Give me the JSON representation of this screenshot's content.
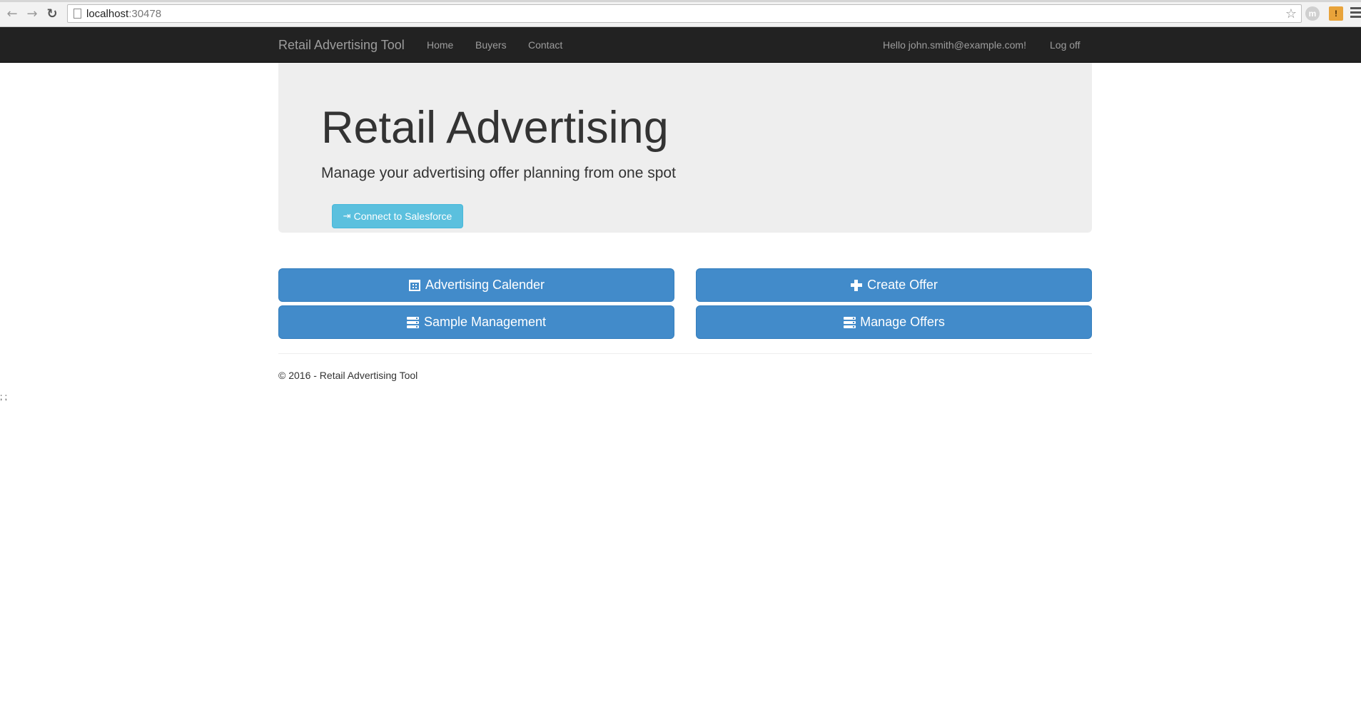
{
  "browser": {
    "back_glyph": "←",
    "forward_glyph": "→",
    "reload_glyph": "↻",
    "url_host": "localhost",
    "url_port": ":30478",
    "star_glyph": "☆",
    "extension_m": "m",
    "extension_b": "!"
  },
  "navbar": {
    "brand": "Retail Advertising Tool",
    "links": [
      "Home",
      "Buyers",
      "Contact"
    ],
    "greeting": "Hello john.smith@example.com!",
    "logoff": "Log off",
    "background": "#222222",
    "text_color": "#9d9d9d"
  },
  "jumbotron": {
    "title": "Retail Advertising",
    "lead": "Manage your advertising offer planning from one spot",
    "connect_icon": "⇥",
    "connect_label": "Connect to Salesforce",
    "background": "#eeeeee"
  },
  "actions": {
    "advertising_calendar": "Advertising Calender",
    "create_offer": "Create Offer",
    "sample_management": "Sample Management",
    "manage_offers": "Manage Offers",
    "primary_color": "#428bca",
    "info_color": "#5bc0de"
  },
  "footer": {
    "copyright": "© 2016 - Retail Advertising Tool",
    "stray_text": "; ;"
  }
}
